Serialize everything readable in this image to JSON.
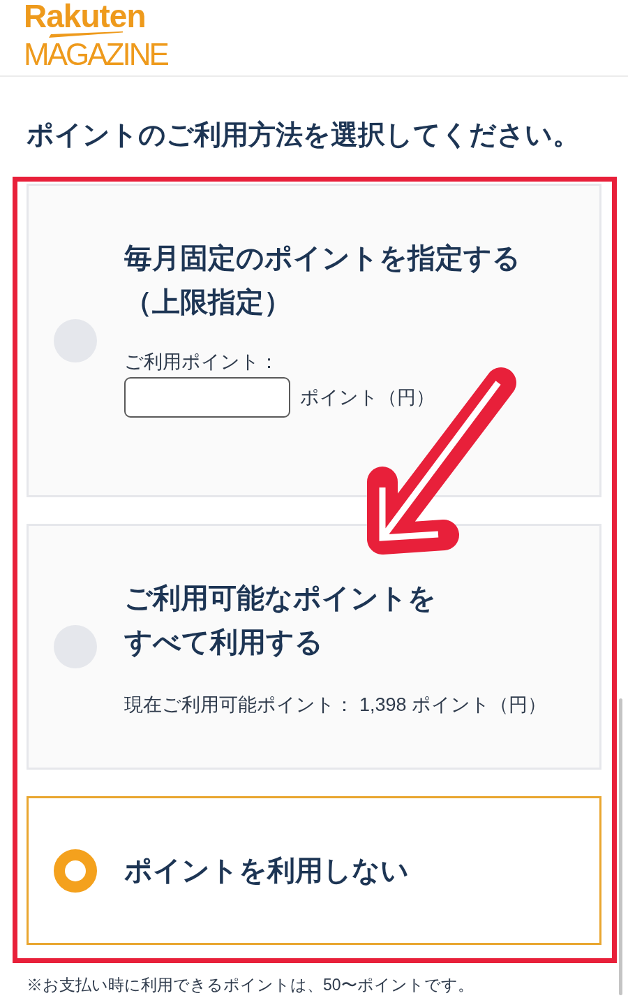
{
  "header": {
    "logo_wordmark": "Rakuten",
    "logo_subtitle": "MAGAZINE"
  },
  "heading": "ポイントのご利用方法を選択してください。",
  "options": [
    {
      "kind": "input",
      "selected": false,
      "title_lines": [
        "毎月固定のポイントを指定する",
        "（上限指定）"
      ],
      "field_label": "ご利用ポイント：",
      "field_unit": "ポイント（円）"
    },
    {
      "kind": "balance",
      "selected": false,
      "title_lines": [
        "ご利用可能なポイントを",
        "すべて利用する"
      ],
      "balance_label": "現在ご利用可能ポイント：",
      "balance_value": "1,398 ポイント（円）"
    },
    {
      "kind": "plain",
      "selected": true,
      "title_lines": [
        "ポイントを利用しない"
      ]
    }
  ],
  "footnote": "※お支払い時に利用できるポイントは、50〜ポイントです。"
}
